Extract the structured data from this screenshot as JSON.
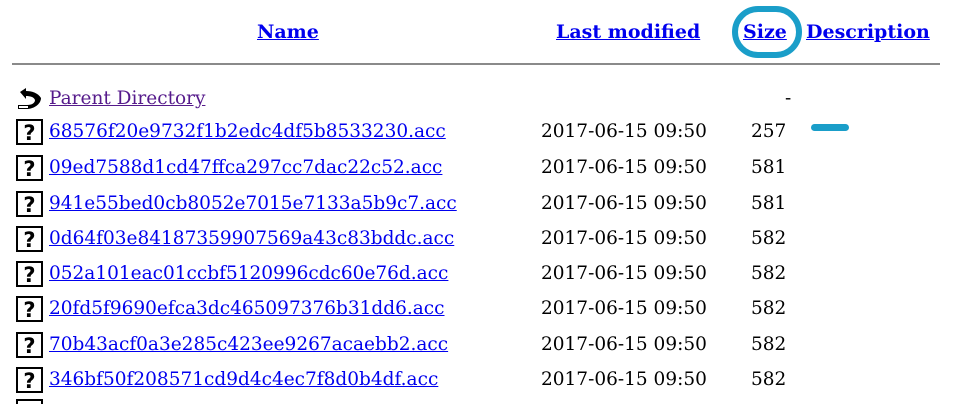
{
  "header": {
    "name_label": "Name",
    "modified_label": "Last modified",
    "size_label": "Size",
    "description_label": "Description"
  },
  "parent": {
    "label": "Parent Directory",
    "size": "-",
    "icon": "back-arrow-icon"
  },
  "files": [
    {
      "name": "68576f20e9732f1b2edc4df5b8533230.acc",
      "modified": "2017-06-15 09:50",
      "size": "257",
      "icon": "unknown-file-icon"
    },
    {
      "name": "09ed7588d1cd47ffca297cc7dac22c52.acc",
      "modified": "2017-06-15 09:50",
      "size": "581",
      "icon": "unknown-file-icon"
    },
    {
      "name": "941e55bed0cb8052e7015e7133a5b9c7.acc",
      "modified": "2017-06-15 09:50",
      "size": "581",
      "icon": "unknown-file-icon"
    },
    {
      "name": "0d64f03e84187359907569a43c83bddc.acc",
      "modified": "2017-06-15 09:50",
      "size": "582",
      "icon": "unknown-file-icon"
    },
    {
      "name": "052a101eac01ccbf5120996cdc60e76d.acc",
      "modified": "2017-06-15 09:50",
      "size": "582",
      "icon": "unknown-file-icon"
    },
    {
      "name": "20fd5f9690efca3dc465097376b31dd6.acc",
      "modified": "2017-06-15 09:50",
      "size": "582",
      "icon": "unknown-file-icon"
    },
    {
      "name": "70b43acf0a3e285c423ee9267acaebb2.acc",
      "modified": "2017-06-15 09:50",
      "size": "582",
      "icon": "unknown-file-icon"
    },
    {
      "name": "346bf50f208571cd9d4c4ec7f8d0b4df.acc",
      "modified": "2017-06-15 09:50",
      "size": "582",
      "icon": "unknown-file-icon"
    }
  ],
  "colors": {
    "link": "#0000ee",
    "visited_link": "#551a8b",
    "annotation": "#1a9ec9",
    "rule": "#8a8a8a"
  }
}
